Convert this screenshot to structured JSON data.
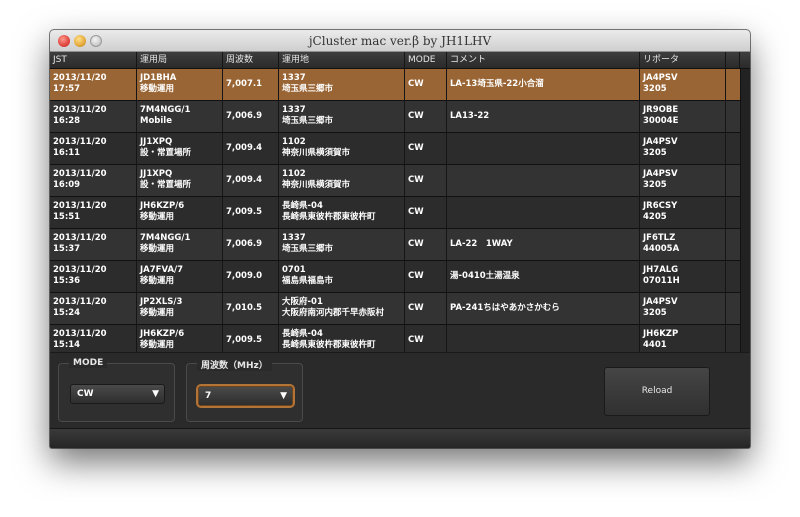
{
  "window": {
    "title": "jCluster mac ver.β by JH1LHV"
  },
  "table": {
    "columns": [
      "JST",
      "運用局",
      "周波数",
      "運用地",
      "MODE",
      "コメント",
      "リポータ"
    ],
    "rows": [
      {
        "date": "2013/11/20",
        "time": "17:57",
        "call": "JD1BHA",
        "call_sub": "移動運用",
        "freq": "7,007.1",
        "loc1": "1337",
        "loc2": "埼玉県三郷市",
        "mode": "CW",
        "comment": "LA-13埼玉県-22小合溜",
        "rep": "JA4PSV",
        "rep_sub": "3205"
      },
      {
        "date": "2013/11/20",
        "time": "16:28",
        "call": "7M4NGG/1",
        "call_sub": "Mobile",
        "freq": "7,006.9",
        "loc1": "1337",
        "loc2": "埼玉県三郷市",
        "mode": "CW",
        "comment": "LA13-22",
        "rep": "JR9OBE",
        "rep_sub": "30004E"
      },
      {
        "date": "2013/11/20",
        "time": "16:11",
        "call": "JJ1XPQ",
        "call_sub": "設・常置場所",
        "freq": "7,009.4",
        "loc1": "1102",
        "loc2": "神奈川県横須賀市",
        "mode": "CW",
        "comment": "",
        "rep": "JA4PSV",
        "rep_sub": "3205"
      },
      {
        "date": "2013/11/20",
        "time": "16:09",
        "call": "JJ1XPQ",
        "call_sub": "設・常置場所",
        "freq": "7,009.4",
        "loc1": "1102",
        "loc2": "神奈川県横須賀市",
        "mode": "CW",
        "comment": "",
        "rep": "JA4PSV",
        "rep_sub": "3205"
      },
      {
        "date": "2013/11/20",
        "time": "15:51",
        "call": "JH6KZP/6",
        "call_sub": "移動運用",
        "freq": "7,009.5",
        "loc1": "長崎県-04",
        "loc2": "長崎県東彼杵郡東彼杵町",
        "mode": "CW",
        "comment": "",
        "rep": "JR6CSY",
        "rep_sub": "4205"
      },
      {
        "date": "2013/11/20",
        "time": "15:37",
        "call": "7M4NGG/1",
        "call_sub": "移動運用",
        "freq": "7,006.9",
        "loc1": "1337",
        "loc2": "埼玉県三郷市",
        "mode": "CW",
        "comment": "LA-22　1WAY",
        "rep": "JF6TLZ",
        "rep_sub": "44005A"
      },
      {
        "date": "2013/11/20",
        "time": "15:36",
        "call": "JA7FVA/7",
        "call_sub": "移動運用",
        "freq": "7,009.0",
        "loc1": "0701",
        "loc2": "福島県福島市",
        "mode": "CW",
        "comment": "湯-0410土湯温泉",
        "rep": "JH7ALG",
        "rep_sub": "07011H"
      },
      {
        "date": "2013/11/20",
        "time": "15:24",
        "call": "JP2XLS/3",
        "call_sub": "移動運用",
        "freq": "7,010.5",
        "loc1": "大阪府-01",
        "loc2": "大阪府南河内郡千早赤阪村",
        "mode": "CW",
        "comment": "PA-241ちはやあかさかむら",
        "rep": "JA4PSV",
        "rep_sub": "3205"
      },
      {
        "date": "2013/11/20",
        "time": "15:14",
        "call": "JH6KZP/6",
        "call_sub": "移動運用",
        "freq": "7,009.5",
        "loc1": "長崎県-04",
        "loc2": "長崎県東彼杵郡東彼杵町",
        "mode": "CW",
        "comment": "",
        "rep": "JH6KZP",
        "rep_sub": "4401"
      }
    ]
  },
  "controls": {
    "mode_label": "MODE",
    "mode_value": "CW",
    "freq_label": "周波数（MHz）",
    "freq_value": "7",
    "reload_label": "Reload"
  },
  "icons": {
    "dropdown": "chevron-down-icon"
  },
  "colors": {
    "selected_row": "#9a6534",
    "focus_ring": "#b47435",
    "background": "#2b2b2b"
  }
}
